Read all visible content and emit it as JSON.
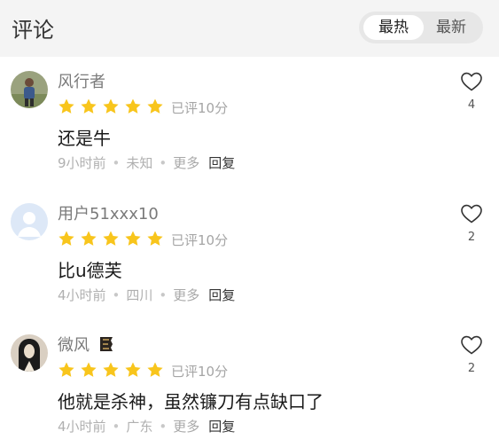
{
  "header": {
    "title": "评论",
    "sort_options": [
      "最热",
      "最新"
    ],
    "selected_sort": "最热"
  },
  "colors": {
    "star": "#f8c51c",
    "header_bg": "#f4f4f4"
  },
  "comments": [
    {
      "username": "风行者",
      "rating_stars": 5,
      "score_text": "已评10分",
      "content": "还是牛",
      "time": "9小时前",
      "location": "未知",
      "more_label": "更多",
      "reply_label": "回复",
      "like_count": "4",
      "avatar_icon": "person-photo-avatar"
    },
    {
      "username": "用户51xxx10",
      "rating_stars": 5,
      "score_text": "已评10分",
      "content": "比u德芙",
      "time": "4小时前",
      "location": "四川",
      "more_label": "更多",
      "reply_label": "回复",
      "like_count": "2",
      "avatar_icon": "default-user-avatar"
    },
    {
      "username": "微风",
      "rating_stars": 5,
      "score_text": "已评10分",
      "content": "他就是杀神，虽然镰刀有点缺口了",
      "time": "4小时前",
      "location": "广东",
      "more_label": "更多",
      "reply_label": "回复",
      "like_count": "2",
      "avatar_icon": "dark-character-avatar",
      "badge_icon": "level-badge-icon"
    }
  ]
}
